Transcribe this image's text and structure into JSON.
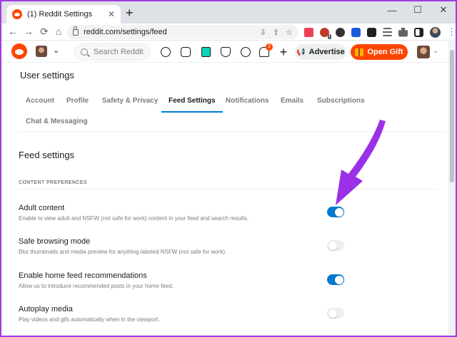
{
  "browser": {
    "tab_title": "(1) Reddit Settings",
    "tab_close": "✕",
    "new_tab": "+",
    "controls": {
      "minimize": "—",
      "maximize": "☐",
      "close": "✕"
    },
    "nav": {
      "back": "←",
      "forward": "→",
      "reload": "⟳",
      "home": "⌂"
    },
    "url": "reddit.com/settings/feed",
    "omnibox_icons": {
      "install": "⇩",
      "share": "⇪",
      "bookmark": "☆"
    },
    "extensions_badge": "1",
    "menu": "⋮"
  },
  "reddit_header": {
    "community_chevron": "⌄",
    "search_placeholder": "Search Reddit",
    "notification_count": "3",
    "plus": "+",
    "advertise_label": "Advertise",
    "megaphone": "📢",
    "open_gift_label": "Open Gift",
    "user_chevron": "⌄"
  },
  "settings": {
    "title": "User settings",
    "tabs": [
      {
        "label": "Account"
      },
      {
        "label": "Profile"
      },
      {
        "label": "Safety & Privacy"
      },
      {
        "label": "Feed Settings",
        "active": true
      },
      {
        "label": "Notifications"
      },
      {
        "label": "Emails"
      },
      {
        "label": "Subscriptions"
      },
      {
        "label": "Chat & Messaging"
      }
    ]
  },
  "feed": {
    "title": "Feed settings",
    "section_header": "CONTENT PREFERENCES",
    "preferences": [
      {
        "title": "Adult content",
        "description": "Enable to view adult and NSFW (not safe for work) content in your feed and search results.",
        "enabled": true
      },
      {
        "title": "Safe browsing mode",
        "description": "Blur thumbnails and media preview for anything labeled NSFW (not safe for work).",
        "enabled": false
      },
      {
        "title": "Enable home feed recommendations",
        "description": "Allow us to introduce recommended posts in your home feed.",
        "enabled": true
      },
      {
        "title": "Autoplay media",
        "description": "Play videos and gifs automatically when in the viewport.",
        "enabled": false
      }
    ]
  },
  "colors": {
    "reddit_orange": "#ff4500",
    "toggle_on": "#0079d3",
    "annotation_arrow": "#9b30e8"
  }
}
